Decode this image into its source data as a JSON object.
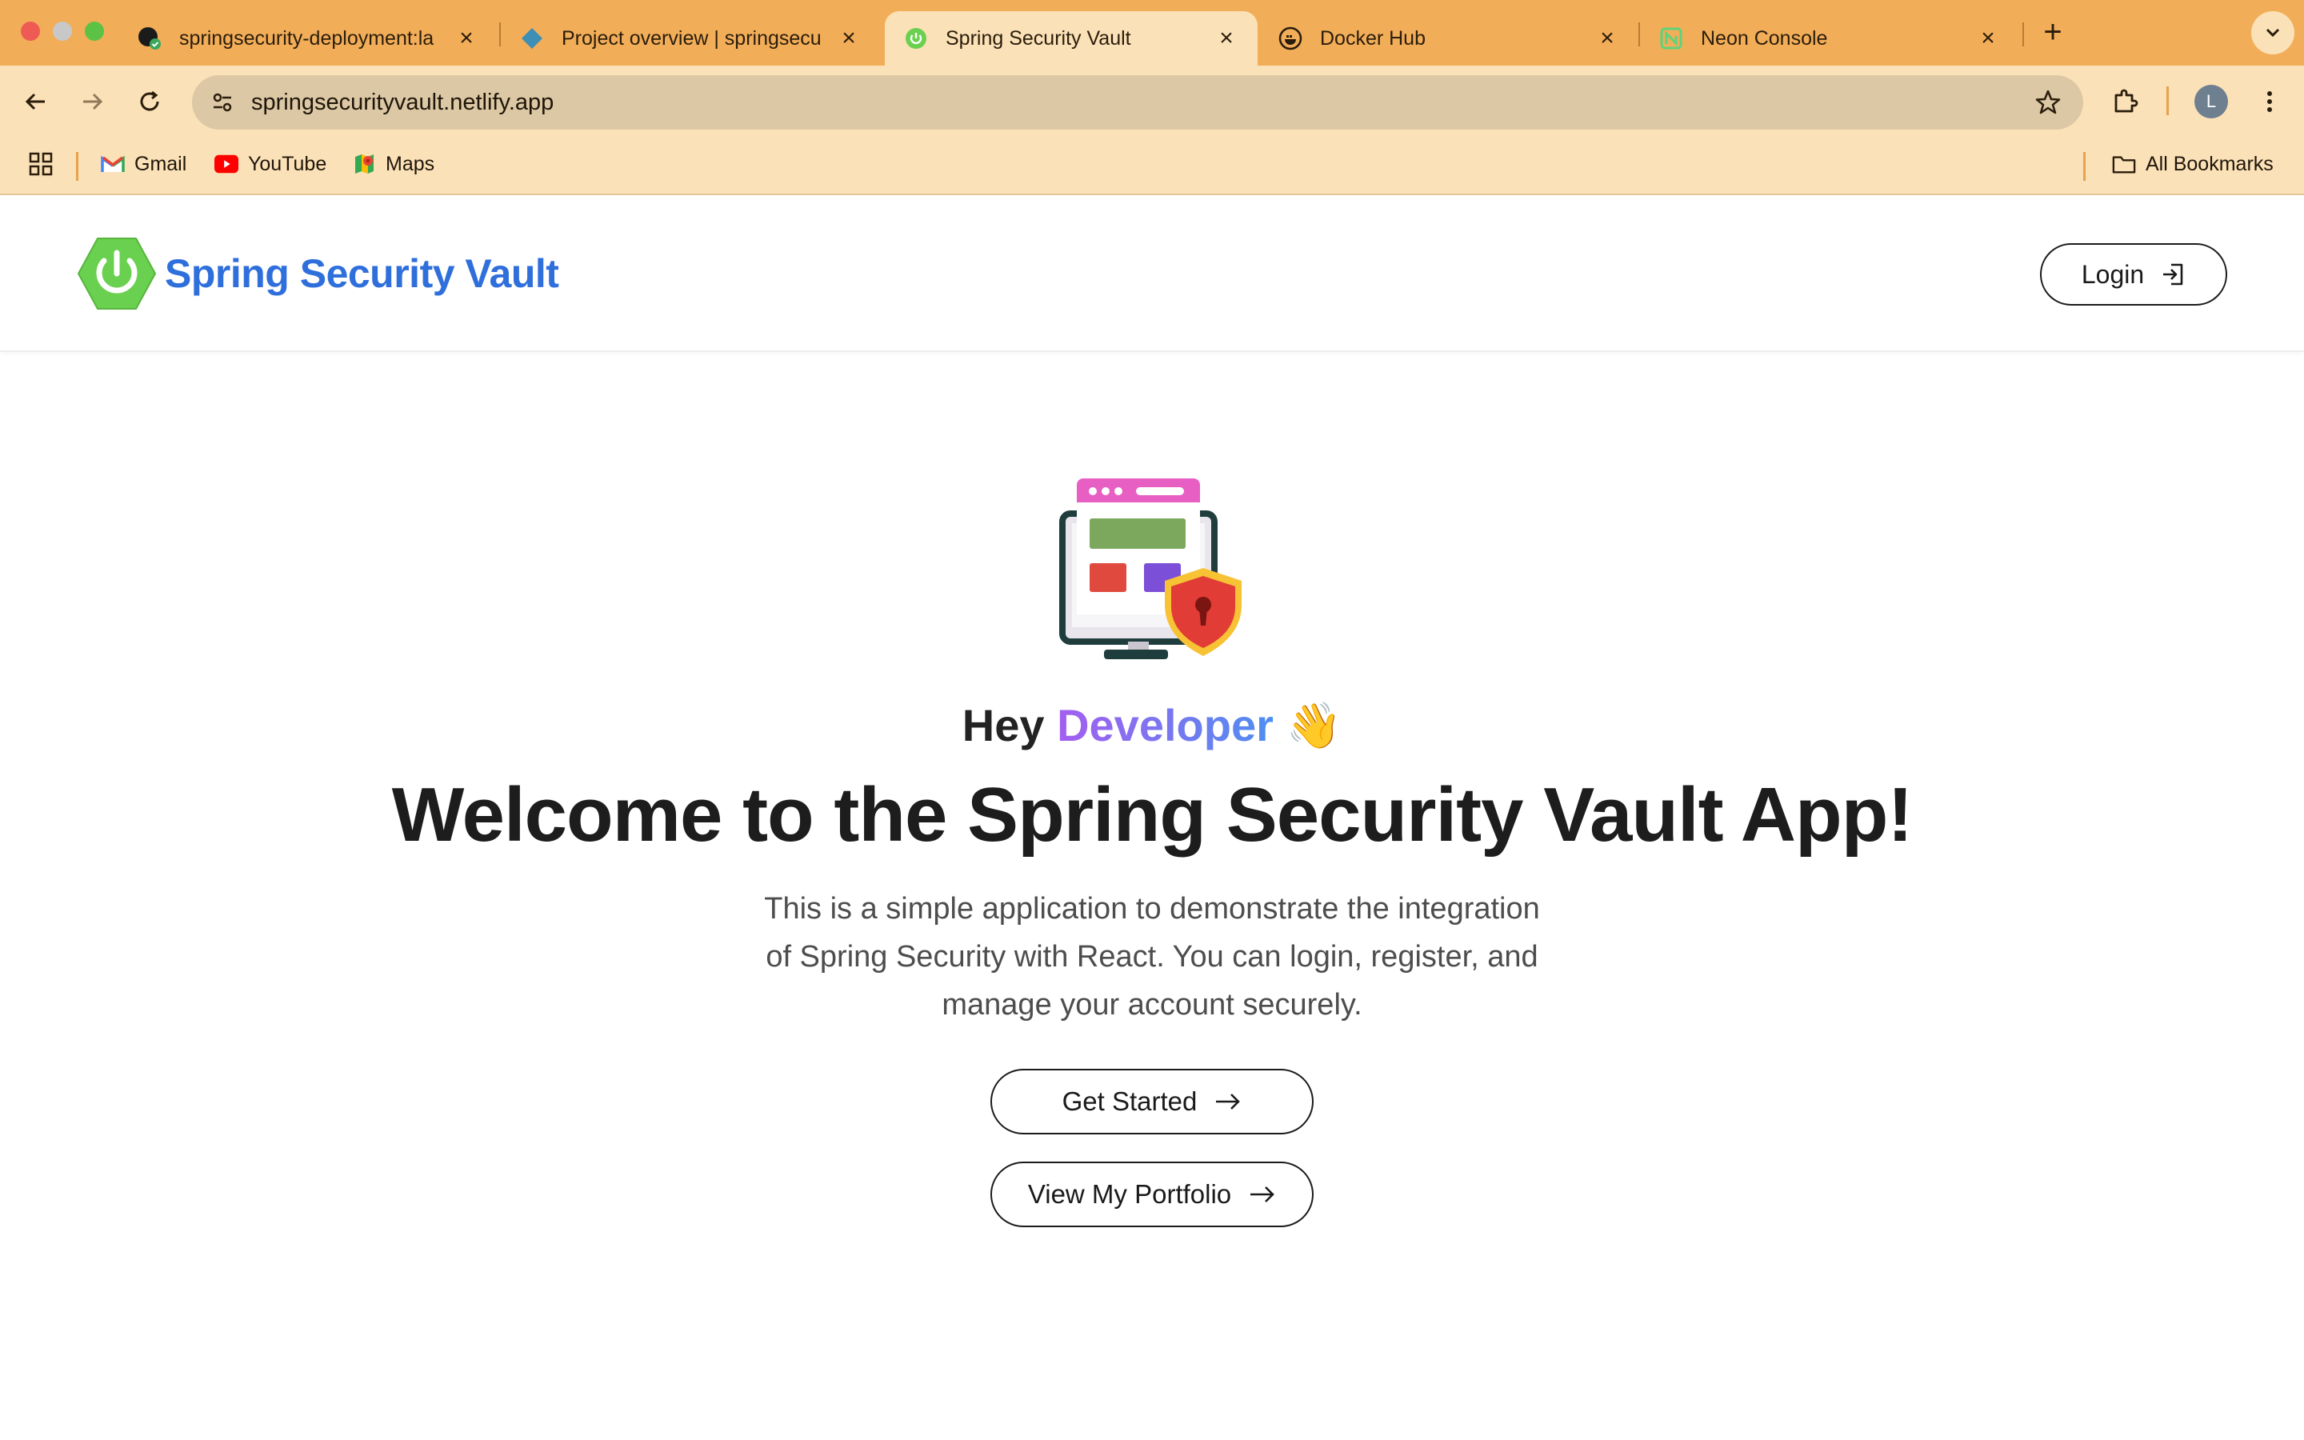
{
  "browser": {
    "tabs": [
      {
        "title": "springsecurity-deployment:la",
        "favicon": "github-icon",
        "active": false
      },
      {
        "title": "Project overview | springsecu",
        "favicon": "render-icon",
        "active": false
      },
      {
        "title": "Spring Security Vault",
        "favicon": "spring-icon",
        "active": true
      },
      {
        "title": "Docker Hub",
        "favicon": "docker-icon",
        "active": false
      },
      {
        "title": "Neon Console",
        "favicon": "neon-icon",
        "active": false
      }
    ],
    "url": "springsecurityvault.netlify.app",
    "avatar_initial": "L",
    "bookmarks": [
      {
        "label": "Gmail",
        "icon": "gmail-icon"
      },
      {
        "label": "YouTube",
        "icon": "youtube-icon"
      },
      {
        "label": "Maps",
        "icon": "maps-icon"
      }
    ],
    "all_bookmarks_label": "All Bookmarks",
    "colors": {
      "tabbar": "#f2ad58",
      "toolbar": "#fbe1b7"
    }
  },
  "app": {
    "brand_name": "Spring Security Vault",
    "login_label": "Login",
    "greeting_prefix": "Hey",
    "greeting_accent": "Developer",
    "greeting_emoji": "👋",
    "headline": "Welcome to the Spring Security Vault App!",
    "description": "This is a simple application to demonstrate the integration of Spring Security with React. You can login, register, and manage your account securely.",
    "get_started_label": "Get Started",
    "portfolio_label": "View My Portfolio",
    "colors": {
      "brand": "#2f6fdc",
      "logo_green": "#6ad04f",
      "accent_gradient": [
        "#a45ef0",
        "#4f8ef0"
      ]
    }
  }
}
